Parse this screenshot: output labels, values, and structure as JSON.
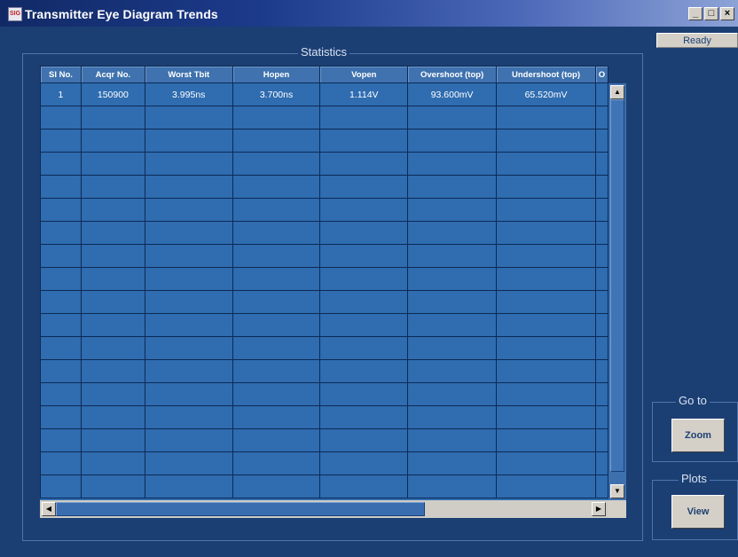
{
  "window": {
    "icon_text": "SIG",
    "title": "Transmitter Eye Diagram Trends",
    "controls": [
      "_",
      "□",
      "×"
    ]
  },
  "status": "Ready",
  "statistics": {
    "group_title": "Statistics",
    "columns": [
      "Sl No.",
      "Acqr No.",
      "Worst Tbit",
      "Hopen",
      "Vopen",
      "Overshoot (top)",
      "Undershoot (top)",
      "O"
    ],
    "rows": [
      [
        "1",
        "150900",
        "3.995ns",
        "3.700ns",
        "1.114V",
        "93.600mV",
        "65.520mV",
        ""
      ]
    ]
  },
  "goto": {
    "group_title": "Go to",
    "zoom_label": "Zoom"
  },
  "plots": {
    "group_title": "Plots",
    "view_label": "View"
  },
  "scrollbars": {
    "up": "▲",
    "down": "▼",
    "left": "◀",
    "right": "▶"
  }
}
